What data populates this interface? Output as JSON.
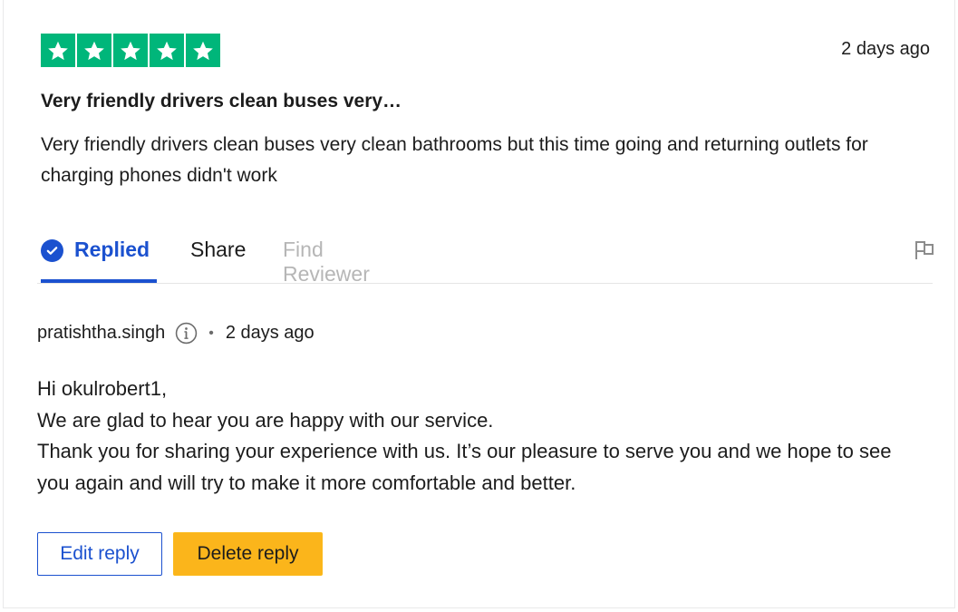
{
  "review": {
    "rating": 5,
    "rating_max": 5,
    "date": "2 days ago",
    "title": "Very friendly drivers clean buses very…",
    "body": "Very friendly drivers clean buses very clean bathrooms but this time going and returning outlets for charging phones didn't work"
  },
  "tabs": {
    "replied": "Replied",
    "share": "Share",
    "find_reviewer": "Find Reviewer",
    "active": "replied"
  },
  "reply": {
    "author": "pratishtha.singh",
    "separator": "•",
    "date": "2 days ago",
    "lines": [
      "Hi okulrobert1,",
      "We are glad to hear you are happy with our service.",
      "Thank you for sharing your experience with us. It’s our pleasure to serve you and we hope to see you again and will try to make it more comfortable and better."
    ]
  },
  "buttons": {
    "edit": "Edit reply",
    "delete": "Delete reply"
  },
  "colors": {
    "star_green": "#00b67a",
    "accent_blue": "#1b51cf",
    "delete_yellow": "#fbb51b"
  },
  "icons": [
    "star-icon",
    "check-circle-icon",
    "flag-icon",
    "info-icon"
  ]
}
